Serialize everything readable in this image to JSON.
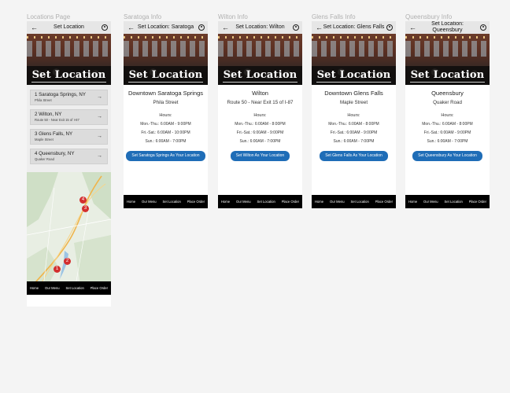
{
  "frames": {
    "locations": "Locations Page",
    "saratoga": "Saratoga Info",
    "wilton": "Wilton Info",
    "glens": "Glens Falls Info",
    "queensbury": "Queensbury Info"
  },
  "icons": {
    "back": "back-arrow-icon",
    "user": "user-account-icon",
    "chevron": "chevron-right-icon",
    "pin": "map-pin-icon"
  },
  "colors": {
    "cta": "#1f6db7",
    "nav": "#000000",
    "pin": "#d32f2f",
    "topbar": "#e6e6e6"
  },
  "arrow_glyph": "→",
  "back_glyph": "←",
  "hero_text": "Set Location",
  "nav": {
    "home": "Home",
    "menu": "Our Menu",
    "set_location": "Set Location",
    "place_order": "Place Order"
  },
  "locations_page": {
    "title": "Set Location",
    "items": [
      {
        "name": "1 Saratoga Springs, NY",
        "sub": "Phila Street"
      },
      {
        "name": "2 Wilton, NY",
        "sub": "Route 50 - Near Exit 15 of I-87"
      },
      {
        "name": "3 Glens Falls, NY",
        "sub": "Maple Street"
      },
      {
        "name": "4 Queensbury, NY",
        "sub": "Quaker Road"
      }
    ],
    "pins": [
      "1",
      "2",
      "3",
      "4"
    ]
  },
  "saratoga": {
    "title": "Set Location: Saratoga",
    "name": "Downtown Saratoga Springs",
    "sub": "Phila Street",
    "hours_title": "Hours:",
    "hours": [
      "Mon.-Thu.: 6:00AM - 9:00PM",
      "Fri.-Sat.: 6:00AM - 10:00PM",
      "Sun.: 6:00AM - 7:00PM"
    ],
    "cta": "Set Saratoga Springs As Your Location"
  },
  "wilton": {
    "title": "Set Location: Wilton",
    "name": "Wilton",
    "sub": "Route 50 - Near Exit 15 of I-87",
    "hours_title": "Hours:",
    "hours": [
      "Mon.-Thu.: 6:00AM - 8:00PM",
      "Fri.-Sat.: 6:00AM - 9:00PM",
      "Sun.: 6:00AM - 7:00PM"
    ],
    "cta": "Set Wilton As Your Location"
  },
  "glens": {
    "title": "Set Location: Glens Falls",
    "name": "Downtown Glens Falls",
    "sub": "Maple Street",
    "hours_title": "Hours:",
    "hours": [
      "Mon.-Thu.: 6:00AM - 8:00PM",
      "Fri.-Sat.: 6:00AM - 9:00PM",
      "Sun.: 6:00AM - 7:00PM"
    ],
    "cta": "Set Glens Falls As Your Location"
  },
  "queensbury": {
    "title": "Set Location: Queensbury",
    "name": "Queensbury",
    "sub": "Quaker Road",
    "hours_title": "Hours:",
    "hours": [
      "Mon.-Thu.: 6:00AM - 8:00PM",
      "Fri.-Sat.: 6:00AM - 9:00PM",
      "Sun.: 6:00AM - 7:00PM"
    ],
    "cta": "Set Queensbury As Your Location"
  }
}
